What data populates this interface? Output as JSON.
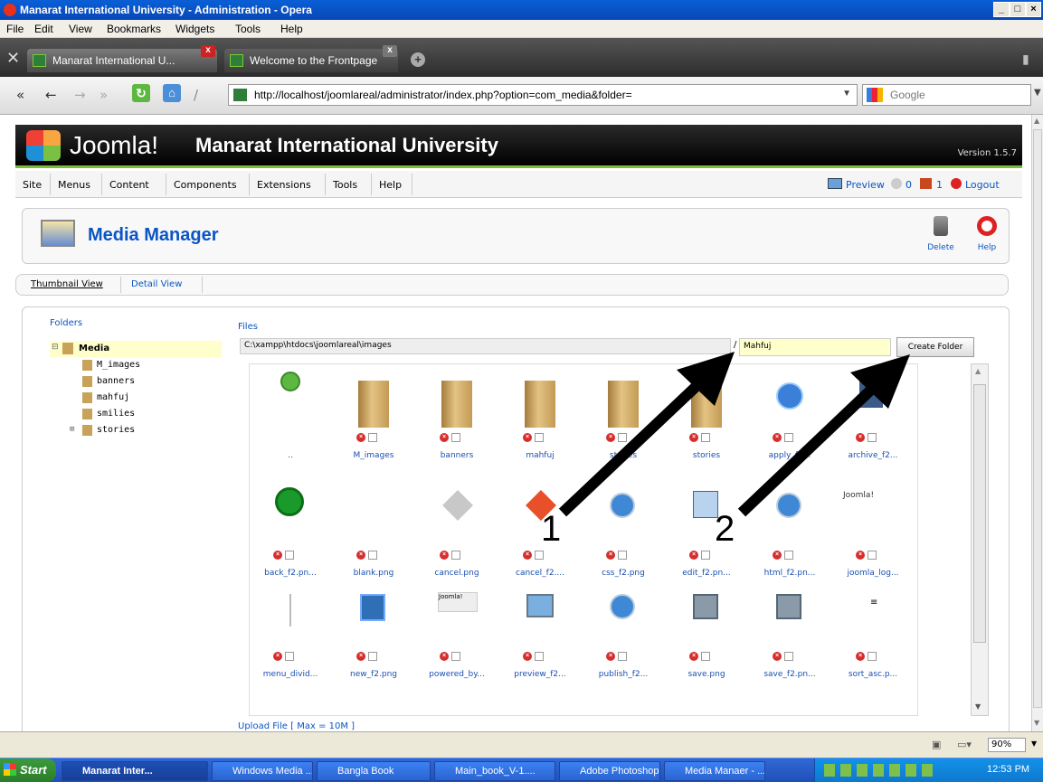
{
  "window": {
    "title": "Manarat International University - Administration - Opera"
  },
  "menubar": [
    "File",
    "Edit",
    "View",
    "Bookmarks",
    "Widgets",
    "Tools",
    "Help"
  ],
  "tabs": [
    {
      "label": "Manarat International U..."
    },
    {
      "label": "Welcome to the Frontpage"
    }
  ],
  "nav": {
    "url": "http://localhost/joomlareal/administrator/index.php?option=com_media&folder=",
    "search_placeholder": "Google"
  },
  "joomla": {
    "logo": "Joomla!",
    "site_name": "Manarat International University",
    "version": "Version 1.5.7",
    "menu": [
      "Site",
      "Menus",
      "Content",
      "Components",
      "Extensions",
      "Tools",
      "Help"
    ],
    "right_links": {
      "preview": "Preview",
      "count1": "0",
      "count2": "1",
      "logout": "Logout"
    },
    "page_title": "Media Manager",
    "toolbar": {
      "delete": "Delete",
      "help": "Help"
    },
    "views": {
      "thumbnail": "Thumbnail View",
      "detail": "Detail View"
    },
    "folders_label": "Folders",
    "tree_root": "Media",
    "tree": [
      "M_images",
      "banners",
      "mahfuj",
      "smilies",
      "stories"
    ],
    "files_label": "Files",
    "path": "C:\\xampp\\htdocs\\joomlareal\\images",
    "path_sep": "/",
    "folder_input": "Mahfuj",
    "create_folder": "Create Folder",
    "upload_label": "Upload File [ Max = 10M ]",
    "thumbs_row1": [
      "..",
      "M_images",
      "banners",
      "mahfuj",
      "stories",
      "stories",
      "apply_f2...",
      "archive_f2..."
    ],
    "thumbs_row2": [
      "back_f2.pn...",
      "blank.png",
      "cancel.png",
      "cancel_f2....",
      "css_f2.png",
      "edit_f2.pn...",
      "html_f2.pn...",
      "joomla_log..."
    ],
    "thumbs_row3": [
      "menu_divid...",
      "new_f2.png",
      "powered_by...",
      "preview_f2...",
      "publish_f2...",
      "save.png",
      "save_f2.pn...",
      "sort_asc.p..."
    ],
    "joomla_small": "Joomla!",
    "powered_small": "Joomla!"
  },
  "annotations": {
    "arrow1": "1",
    "arrow2": "2"
  },
  "status": {
    "zoom": "90%"
  },
  "taskbar": {
    "start": "Start",
    "items": [
      "Manarat Inter...",
      "Windows Media ...",
      "Bangla Book",
      "Main_book_V-1....",
      "Adobe Photoshop",
      "Media Manaer - ..."
    ],
    "clock": "12:53 PM"
  },
  "colors": {
    "joomla_green": "#7cbc3b",
    "link_blue": "#0b55c4",
    "taskbar_blue": "#245edb"
  }
}
